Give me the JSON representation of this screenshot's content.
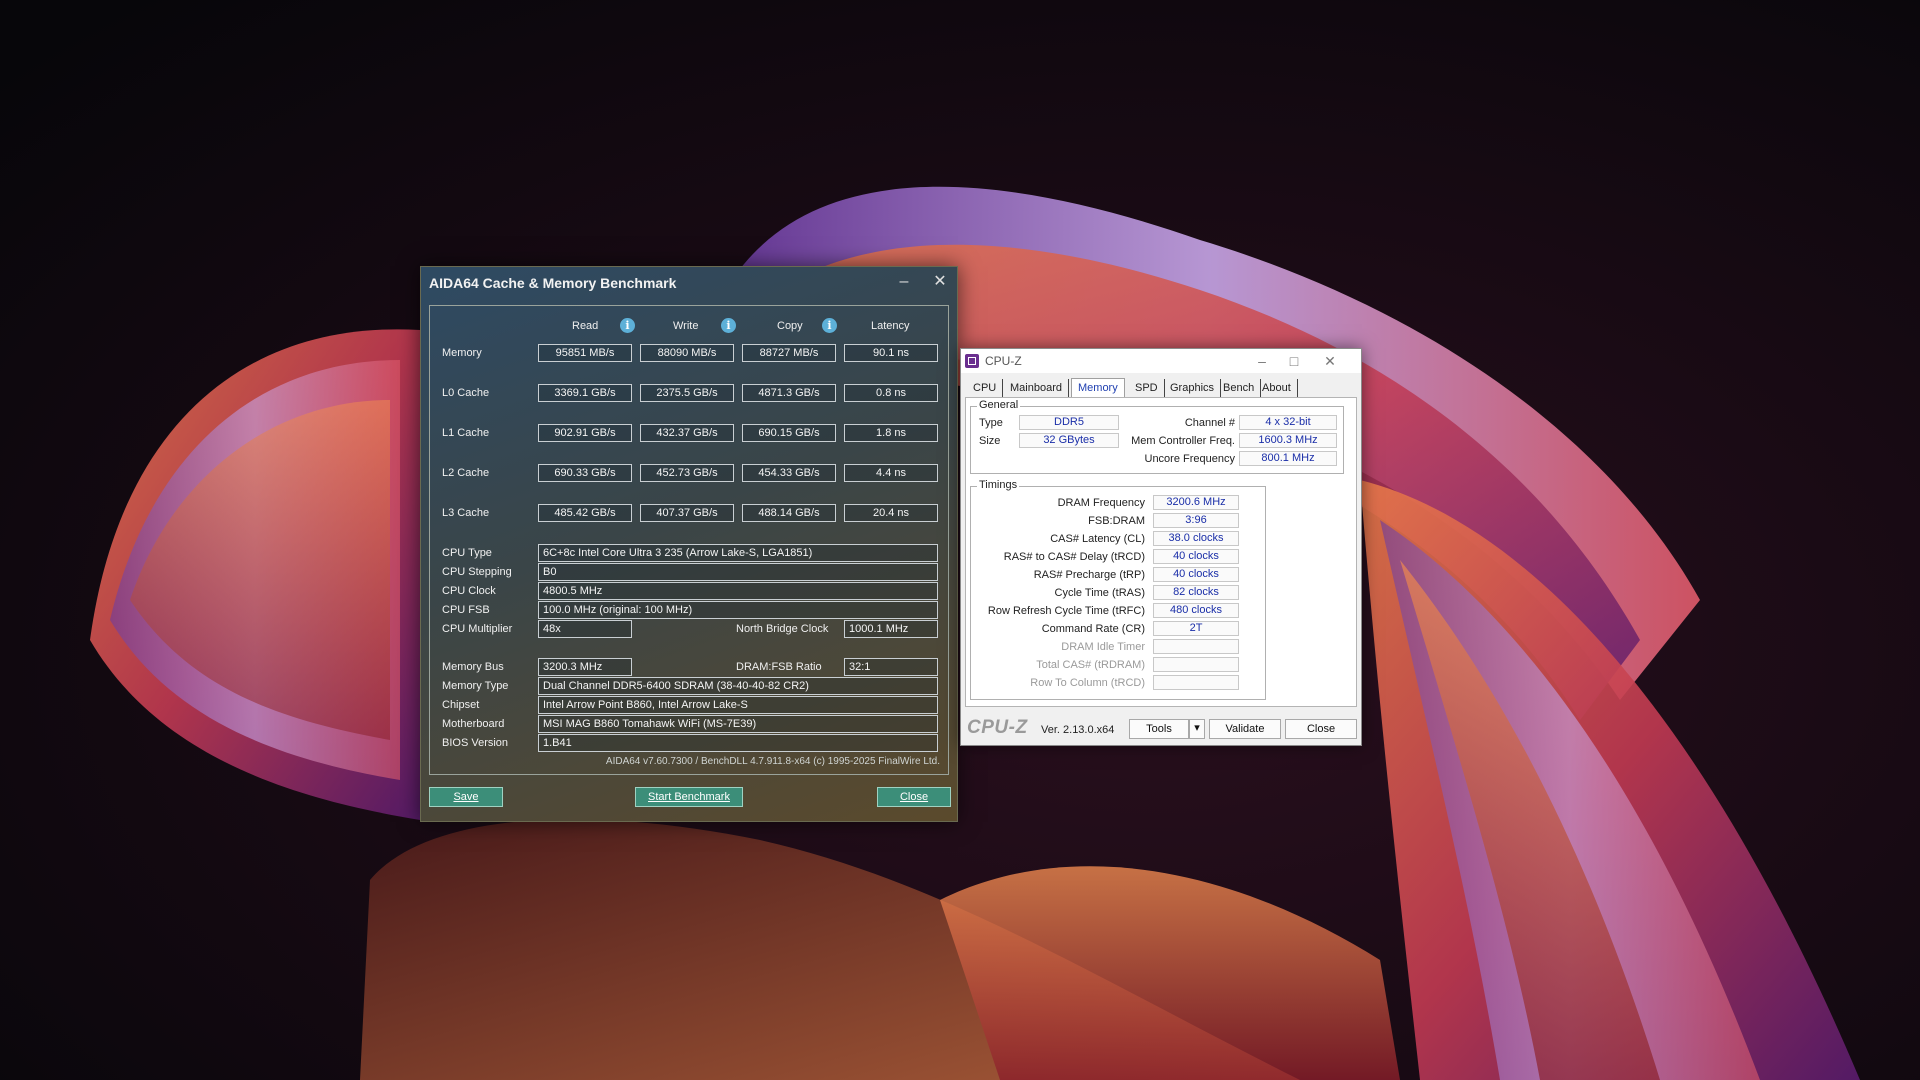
{
  "aida64": {
    "title": "AIDA64 Cache & Memory Benchmark",
    "columns": {
      "read": "Read",
      "write": "Write",
      "copy": "Copy",
      "latency": "Latency"
    },
    "rows": [
      {
        "label": "Memory",
        "read": "95851 MB/s",
        "write": "88090 MB/s",
        "copy": "88727 MB/s",
        "latency": "90.1 ns"
      },
      {
        "label": "L0 Cache",
        "read": "3369.1 GB/s",
        "write": "2375.5 GB/s",
        "copy": "4871.3 GB/s",
        "latency": "0.8 ns"
      },
      {
        "label": "L1 Cache",
        "read": "902.91 GB/s",
        "write": "432.37 GB/s",
        "copy": "690.15 GB/s",
        "latency": "1.8 ns"
      },
      {
        "label": "L2 Cache",
        "read": "690.33 GB/s",
        "write": "452.73 GB/s",
        "copy": "454.33 GB/s",
        "latency": "4.4 ns"
      },
      {
        "label": "L3 Cache",
        "read": "485.42 GB/s",
        "write": "407.37 GB/s",
        "copy": "488.14 GB/s",
        "latency": "20.4 ns"
      }
    ],
    "info": {
      "cpu_type_label": "CPU Type",
      "cpu_type": "6C+8c Intel Core Ultra 3 235  (Arrow Lake-S, LGA1851)",
      "cpu_stepping_label": "CPU Stepping",
      "cpu_stepping": "B0",
      "cpu_clock_label": "CPU Clock",
      "cpu_clock": "4800.5 MHz",
      "cpu_fsb_label": "CPU FSB",
      "cpu_fsb": "100.0 MHz  (original: 100 MHz)",
      "cpu_multiplier_label": "CPU Multiplier",
      "cpu_multiplier": "48x",
      "nb_clock_label": "North Bridge Clock",
      "nb_clock": "1000.1 MHz",
      "memory_bus_label": "Memory Bus",
      "memory_bus": "3200.3 MHz",
      "dram_fsb_label": "DRAM:FSB Ratio",
      "dram_fsb": "32:1",
      "memory_type_label": "Memory Type",
      "memory_type": "Dual Channel DDR5-6400 SDRAM  (38-40-40-82 CR2)",
      "chipset_label": "Chipset",
      "chipset": "Intel Arrow Point B860, Intel Arrow Lake-S",
      "motherboard_label": "Motherboard",
      "motherboard": "MSI MAG B860 Tomahawk WiFi (MS-7E39)",
      "bios_label": "BIOS Version",
      "bios": "1.B41"
    },
    "footer": "AIDA64 v7.60.7300 / BenchDLL 4.7.911.8-x64  (c) 1995-2025 FinalWire Ltd.",
    "buttons": {
      "save": "Save",
      "start": "Start Benchmark",
      "close": "Close"
    }
  },
  "cpuz": {
    "title": "CPU-Z",
    "tabs": [
      "CPU",
      "Mainboard",
      "Memory",
      "SPD",
      "Graphics",
      "Bench",
      "About"
    ],
    "active_tab": "Memory",
    "general": {
      "group_label": "General",
      "type_label": "Type",
      "type": "DDR5",
      "size_label": "Size",
      "size": "32 GBytes",
      "channel_label": "Channel #",
      "channel": "4 x 32-bit",
      "mcf_label": "Mem Controller Freq.",
      "mcf": "1600.3 MHz",
      "uncore_label": "Uncore Frequency",
      "uncore": "800.1 MHz"
    },
    "timings": {
      "group_label": "Timings",
      "rows": [
        {
          "label": "DRAM Frequency",
          "value": "3200.6 MHz"
        },
        {
          "label": "FSB:DRAM",
          "value": "3:96"
        },
        {
          "label": "CAS# Latency (CL)",
          "value": "38.0 clocks"
        },
        {
          "label": "RAS# to CAS# Delay (tRCD)",
          "value": "40 clocks"
        },
        {
          "label": "RAS# Precharge (tRP)",
          "value": "40 clocks"
        },
        {
          "label": "Cycle Time (tRAS)",
          "value": "82 clocks"
        },
        {
          "label": "Row Refresh Cycle Time (tRFC)",
          "value": "480 clocks"
        },
        {
          "label": "Command Rate (CR)",
          "value": "2T"
        },
        {
          "label": "DRAM Idle Timer",
          "value": ""
        },
        {
          "label": "Total CAS# (tRDRAM)",
          "value": ""
        },
        {
          "label": "Row To Column (tRCD)",
          "value": ""
        }
      ]
    },
    "brand": "CPU-Z",
    "version": "Ver. 2.13.0.x64",
    "buttons": {
      "tools": "Tools",
      "validate": "Validate",
      "close": "Close"
    }
  }
}
